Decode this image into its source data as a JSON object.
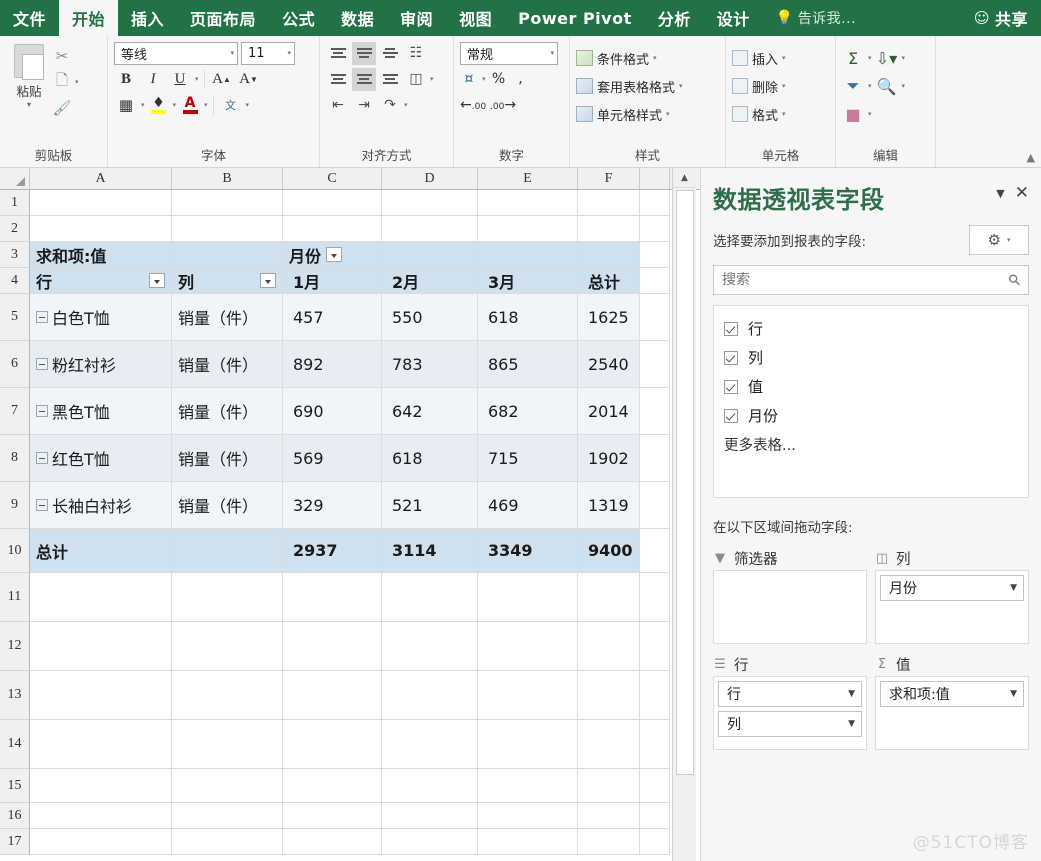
{
  "ribbon": {
    "tabs": [
      {
        "label": "文件",
        "active": false
      },
      {
        "label": "开始",
        "active": true
      },
      {
        "label": "插入",
        "active": false
      },
      {
        "label": "页面布局",
        "active": false
      },
      {
        "label": "公式",
        "active": false
      },
      {
        "label": "数据",
        "active": false
      },
      {
        "label": "审阅",
        "active": false
      },
      {
        "label": "视图",
        "active": false
      },
      {
        "label": "Power Pivot",
        "active": false
      },
      {
        "label": "分析",
        "active": false
      },
      {
        "label": "设计",
        "active": false
      }
    ],
    "tell_me": "告诉我...",
    "share": "共享",
    "groups": {
      "clipboard": {
        "label": "剪贴板",
        "paste": "粘贴",
        "cut": "剪切",
        "copy": "复制",
        "format_painter": "格式刷"
      },
      "font": {
        "label": "字体",
        "font_name": "等线",
        "font_size": "11",
        "bold": "B",
        "italic": "I",
        "underline": "U",
        "grow_font": "A",
        "shrink_font": "A",
        "borders": "边框",
        "fill_color": "填充颜色",
        "font_color": "字体颜色",
        "phonetic": "拼音"
      },
      "alignment": {
        "label": "对齐方式"
      },
      "number": {
        "label": "数字",
        "format": "常规",
        "percent": "%",
        "comma": ",",
        "inc_decimal": "增加小数位数",
        "dec_decimal": "减少小数位数"
      },
      "styles": {
        "label": "样式",
        "conditional": "条件格式",
        "table_format": "套用表格格式",
        "cell_styles": "单元格样式"
      },
      "cells": {
        "label": "单元格",
        "insert": "插入",
        "delete": "删除",
        "format": "格式"
      },
      "editing": {
        "label": "编辑",
        "autosum": "Σ",
        "fill": "填充",
        "clear": "清除",
        "sort_filter": "排序和筛选",
        "find_select": "查找和选择"
      }
    }
  },
  "sheet": {
    "columns": [
      "A",
      "B",
      "C",
      "D",
      "E",
      "F"
    ],
    "row_numbers": [
      "1",
      "2",
      "3",
      "4",
      "5",
      "6",
      "7",
      "8",
      "9",
      "10",
      "11",
      "12",
      "13",
      "14",
      "15",
      "16",
      "17"
    ],
    "pivot": {
      "value_caption": "求和项:值",
      "column_field": "月份",
      "row_label": "行",
      "col_label": "列",
      "headers": [
        "1月",
        "2月",
        "3月",
        "总计"
      ],
      "rows": [
        {
          "name": "白色T恤",
          "metric": "销量（件）",
          "values": [
            "457",
            "550",
            "618",
            "1625"
          ]
        },
        {
          "name": "粉红衬衫",
          "metric": "销量（件）",
          "values": [
            "892",
            "783",
            "865",
            "2540"
          ]
        },
        {
          "name": "黑色T恤",
          "metric": "销量（件）",
          "values": [
            "690",
            "642",
            "682",
            "2014"
          ]
        },
        {
          "name": "红色T恤",
          "metric": "销量（件）",
          "values": [
            "569",
            "618",
            "715",
            "1902"
          ]
        },
        {
          "name": "长袖白衬衫",
          "metric": "销量（件）",
          "values": [
            "329",
            "521",
            "469",
            "1319"
          ]
        }
      ],
      "grand_total_label": "总计",
      "grand_total_values": [
        "2937",
        "3114",
        "3349",
        "9400"
      ]
    }
  },
  "pane": {
    "title": "数据透视表字段",
    "subtitle": "选择要添加到报表的字段:",
    "search_placeholder": "搜索",
    "fields": [
      {
        "label": "行",
        "checked": true
      },
      {
        "label": "列",
        "checked": true
      },
      {
        "label": "值",
        "checked": true
      },
      {
        "label": "月份",
        "checked": true
      }
    ],
    "more_tables": "更多表格...",
    "drag_label": "在以下区域间拖动字段:",
    "zones": [
      {
        "name": "filters",
        "label": "筛选器",
        "icon": "filter-icon",
        "items": []
      },
      {
        "name": "columns",
        "label": "列",
        "icon": "columns-icon",
        "items": [
          "月份"
        ]
      },
      {
        "name": "rows",
        "label": "行",
        "icon": "rows-icon",
        "items": [
          "行",
          "列"
        ]
      },
      {
        "name": "values",
        "label": "值",
        "icon": "sigma-icon",
        "items": [
          "求和项:值"
        ]
      }
    ]
  },
  "watermark": "@51CTO博客"
}
